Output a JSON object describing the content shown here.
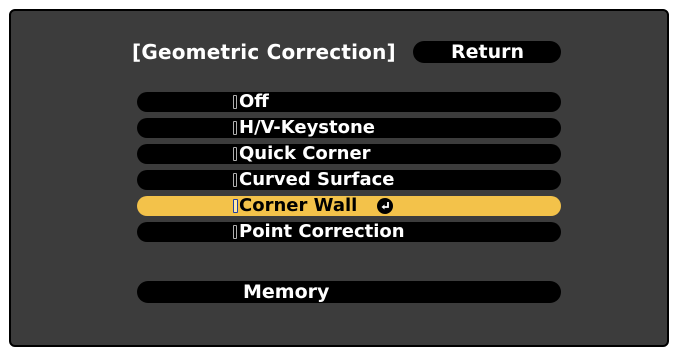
{
  "header": {
    "title": "[Geometric Correction]",
    "return_label": "Return"
  },
  "menu": {
    "items": [
      {
        "label": "Off",
        "selected": false
      },
      {
        "label": "H/V-Keystone",
        "selected": false
      },
      {
        "label": "Quick Corner",
        "selected": false
      },
      {
        "label": "Curved Surface",
        "selected": false
      },
      {
        "label": "Corner Wall",
        "selected": true
      },
      {
        "label": "Point Correction",
        "selected": false
      }
    ]
  },
  "memory": {
    "label": "Memory"
  },
  "colors": {
    "background": "#3c3c3c",
    "bar": "#000000",
    "highlight": "#f3c24a",
    "text": "#ffffff"
  },
  "icons": {
    "enter": "enter-icon"
  }
}
